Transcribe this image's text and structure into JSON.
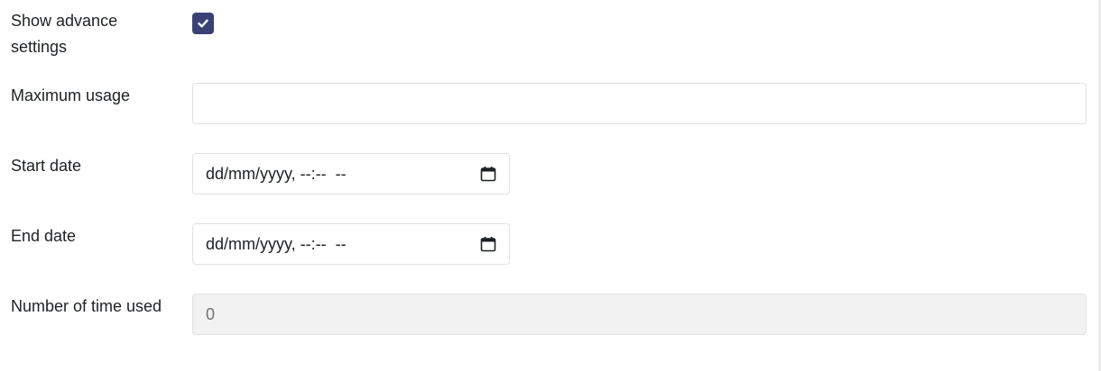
{
  "form": {
    "advance": {
      "label": "Show advance settings",
      "checked": true,
      "icon": "check-icon"
    },
    "max_usage": {
      "label": "Maximum usage",
      "value": "",
      "placeholder": ""
    },
    "start_date": {
      "label": "Start date",
      "value": "dd/mm/yyyy, --:--  --",
      "icon": "calendar-icon"
    },
    "end_date": {
      "label": "End date",
      "value": "dd/mm/yyyy, --:--  --",
      "icon": "calendar-icon"
    },
    "times_used": {
      "label": "Number of time used",
      "value": "0"
    }
  },
  "colors": {
    "checkbox": "#3a4275",
    "border": "#dee2e6",
    "disabled_bg": "#f2f2f2"
  }
}
